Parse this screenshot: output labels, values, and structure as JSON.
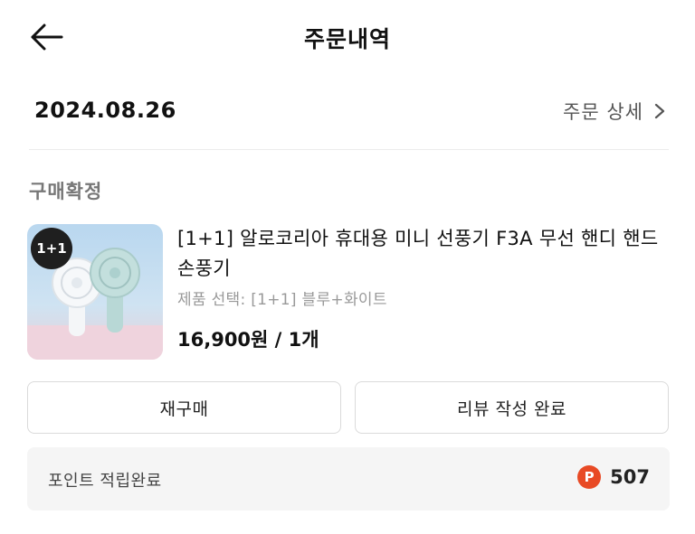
{
  "header": {
    "title": "주문내역",
    "back_icon": "arrow-left-icon"
  },
  "order": {
    "date": "2024.08.26",
    "detail_label": "주문 상세",
    "detail_icon": "chevron-right-icon"
  },
  "status": "구매확정",
  "product": {
    "badge": "1+1",
    "name": "[1+1] 알로코리아 휴대용 미니 선풍기 F3A 무선 핸디 핸드 손풍기",
    "option": "제품 선택: [1+1] 블루+화이트",
    "price": "16,900원 / 1개"
  },
  "buttons": {
    "rebuy": "재구매",
    "review": "리뷰 작성 완료"
  },
  "points": {
    "label": "포인트 적립완료",
    "icon_text": "P",
    "value": "507",
    "icon_color": "#e84a25"
  }
}
